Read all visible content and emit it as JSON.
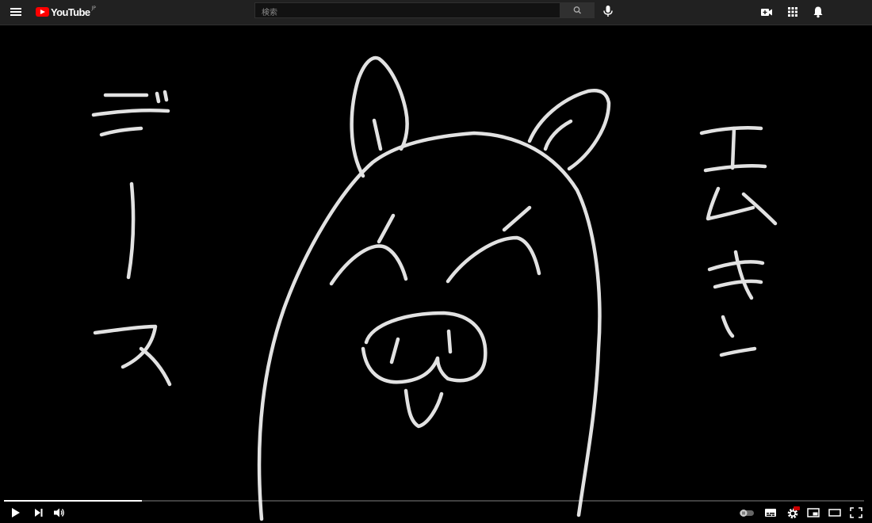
{
  "header": {
    "logo_text": "YouTube",
    "region": "JP",
    "search_placeholder": "検索"
  },
  "player": {
    "progress_fraction": 0.16
  },
  "colors": {
    "topbar": "#212121",
    "youtube_red": "#ff0000",
    "stroke": "#e2e2e2"
  }
}
